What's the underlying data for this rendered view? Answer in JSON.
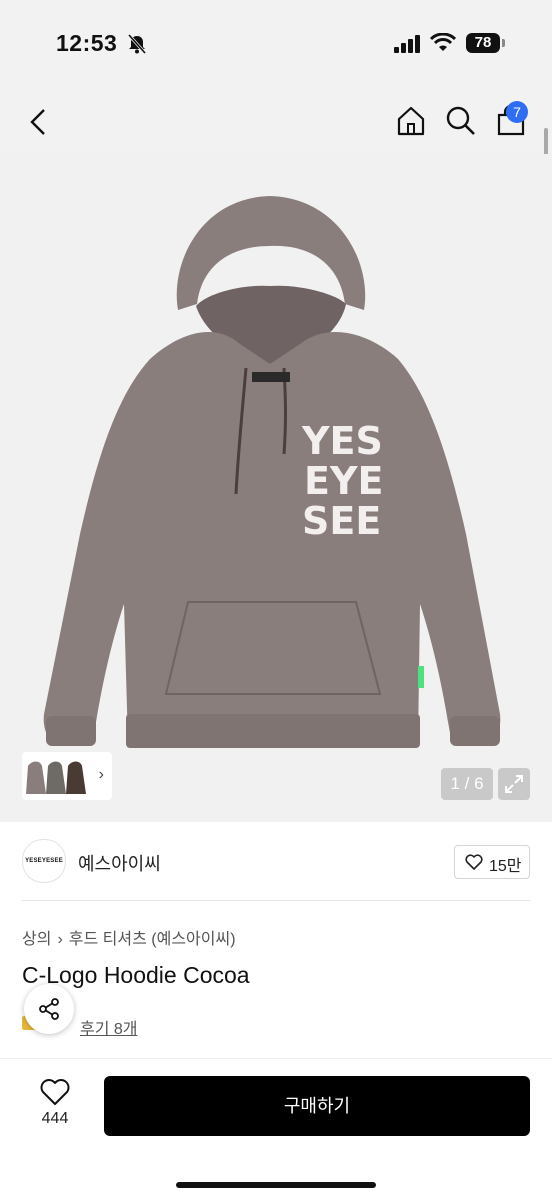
{
  "status": {
    "time": "12:53",
    "battery": "78"
  },
  "header": {
    "cart_badge": "7"
  },
  "gallery": {
    "counter": "1 / 6",
    "thumb_chevron": "›"
  },
  "brand": {
    "logo_text": "YESEYESEE",
    "name": "예스아이씨",
    "likes": "15만"
  },
  "breadcrumb": {
    "level1": "상의",
    "separator": "›",
    "level2": "후드 티셔츠 (예스아이씨)"
  },
  "product": {
    "title": "C-Logo Hoodie Cocoa",
    "reviews": "후기 8개",
    "print_text": [
      "YES",
      "EYE",
      "SEE"
    ],
    "neck_label": "YESEYESEE"
  },
  "bottom": {
    "wish_count": "444",
    "buy_label": "구매하기"
  },
  "colors": {
    "hoodie": "#8a7e7c",
    "hoodie_shadow": "#776c6a",
    "badge": "#2f6df5",
    "buy_bg": "#000000"
  },
  "icons": [
    "bell-slash-icon",
    "signal-icon",
    "wifi-icon",
    "back-chevron-icon",
    "home-icon",
    "search-icon",
    "cart-icon",
    "expand-icon",
    "heart-icon",
    "share-icon"
  ]
}
